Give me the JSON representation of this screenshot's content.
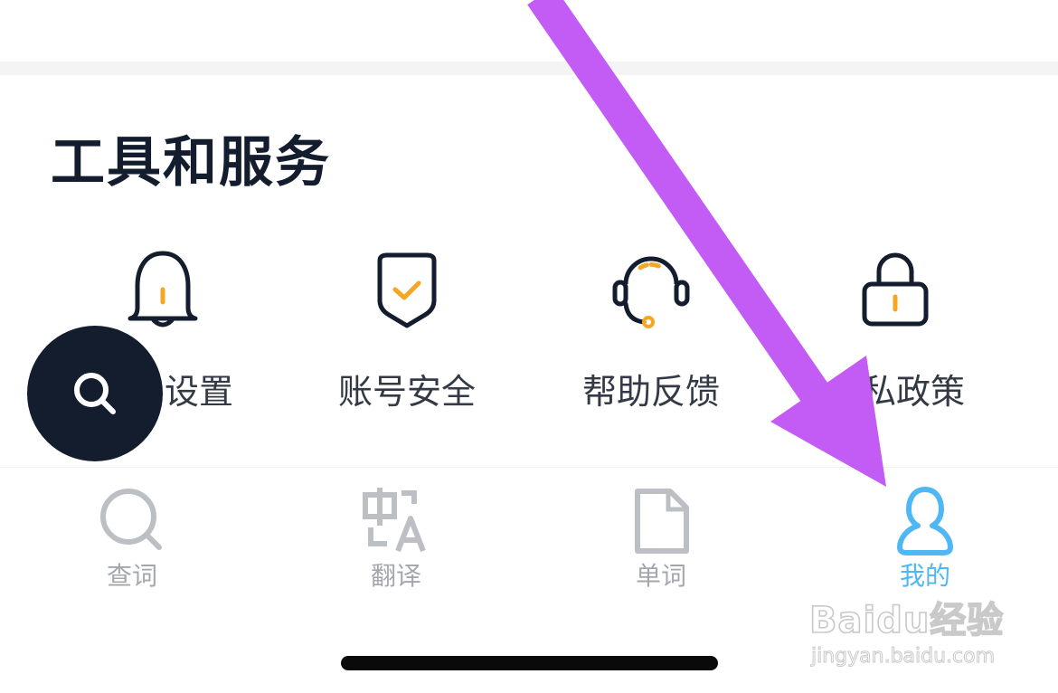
{
  "section": {
    "title": "工具和服务"
  },
  "tools": [
    {
      "label": "设置",
      "icon": "bell-icon"
    },
    {
      "label": "账号安全",
      "icon": "shield-check-icon"
    },
    {
      "label": "帮助反馈",
      "icon": "headset-icon"
    },
    {
      "label": "私政策",
      "icon": "lock-icon"
    }
  ],
  "fab": {
    "icon": "search-icon"
  },
  "tabbar": {
    "items": [
      {
        "label": "查词",
        "icon": "search-icon",
        "active": false
      },
      {
        "label": "翻译",
        "icon": "translate-icon",
        "active": false
      },
      {
        "label": "单词",
        "icon": "document-icon",
        "active": false
      },
      {
        "label": "我的",
        "icon": "user-icon",
        "active": true
      }
    ]
  },
  "watermark": {
    "logo": "Baidu经验",
    "sub": "jingyan.baidu.com"
  },
  "colors": {
    "navy": "#141d2e",
    "accent_orange": "#f5a623",
    "tab_active": "#4fb7f3",
    "tab_inactive": "#a3a7ad",
    "annotation_arrow": "#c35cf5"
  }
}
